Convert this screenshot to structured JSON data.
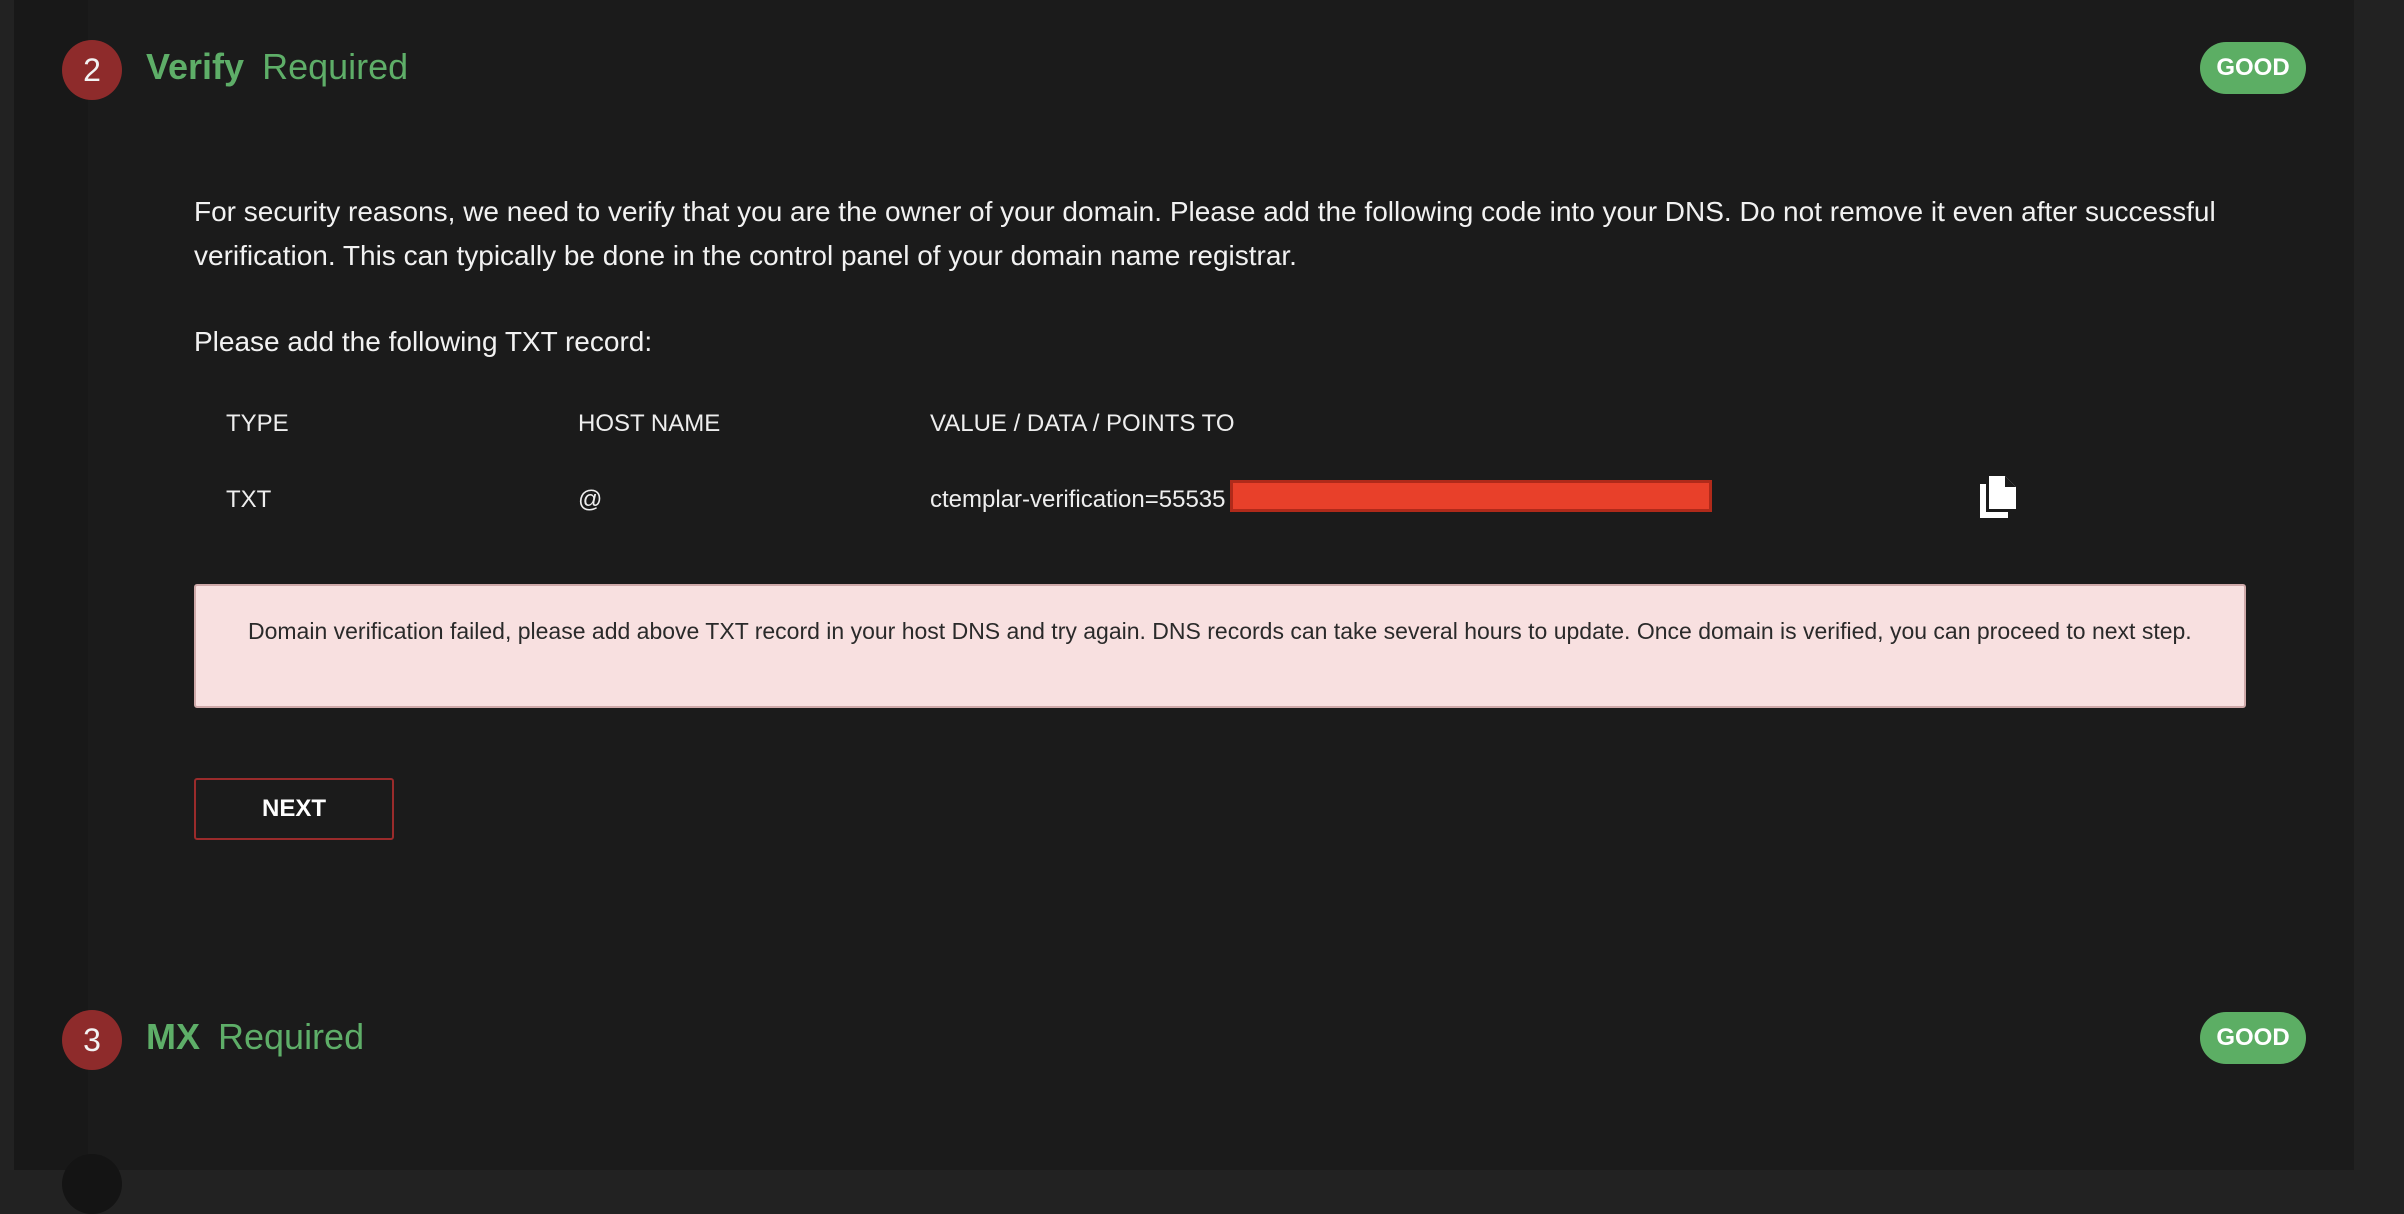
{
  "steps": [
    {
      "number": "2",
      "name": "Verify",
      "status_text": "Required",
      "badge": "GOOD"
    },
    {
      "number": "3",
      "name": "MX",
      "status_text": "Required",
      "badge": "GOOD"
    }
  ],
  "verify": {
    "description": "For security reasons, we need to verify that you are the owner of your domain. Please add the following code into your DNS. Do not remove it even after successful verification. This can typically be done in the control panel of your domain name registrar.",
    "txt_prompt": "Please add the following TXT record:",
    "table": {
      "headers": [
        "TYPE",
        "HOST NAME",
        "VALUE / DATA / POINTS TO"
      ],
      "row": {
        "type": "TXT",
        "host": "@",
        "value": "ctemplar-verification=55535"
      }
    },
    "error": "Domain verification failed, please add above TXT record in your host DNS and try again. DNS records can take several hours to update. Once domain is verified, you can proceed to next step.",
    "next_label": "NEXT"
  },
  "icons": {
    "copy": "copy-icon"
  },
  "colors": {
    "accent_green": "#5eae68",
    "step_red": "#8e2b2b",
    "alert_bg": "#f8e0e0",
    "redaction": "#e8402a"
  }
}
